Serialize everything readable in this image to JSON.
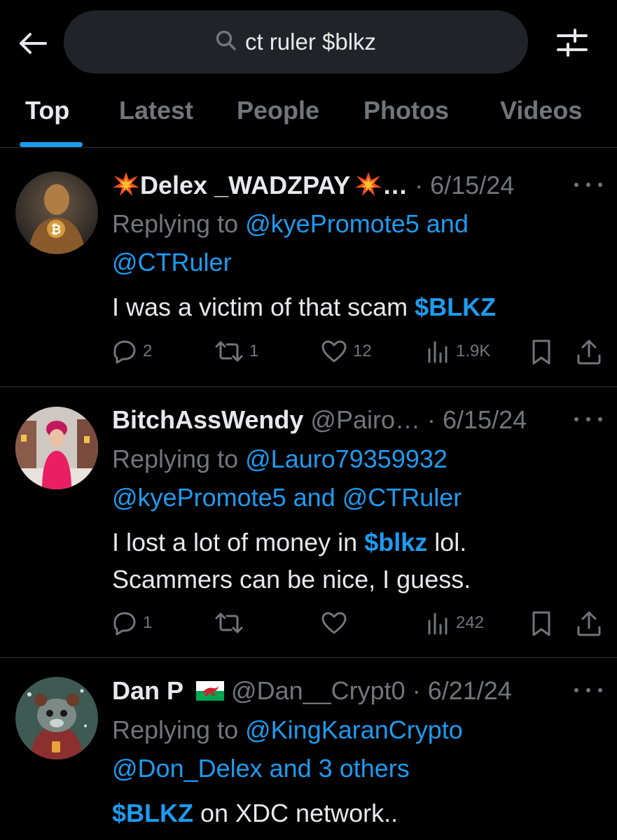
{
  "header": {
    "search_query": "ct ruler $blkz"
  },
  "tabs": [
    {
      "label": "Top",
      "active": true
    },
    {
      "label": "Latest",
      "active": false
    },
    {
      "label": "People",
      "active": false
    },
    {
      "label": "Photos",
      "active": false
    },
    {
      "label": "Videos",
      "active": false
    }
  ],
  "tweets": [
    {
      "display_name": "Delex _WADZPAY",
      "handle": "…",
      "date": "6/15/24",
      "replying_prefix": "Replying to",
      "replying_line1": "@kyePromote5 and",
      "replying_line2": "@CTRuler",
      "text_pre": "I was a victim of that scam ",
      "cashtag": "$BLKZ",
      "replies": "2",
      "retweets": "1",
      "likes": "12",
      "views": "1.9K"
    },
    {
      "display_name": "BitchAssWendy",
      "handle": "@Pairo…",
      "date": "6/15/24",
      "replying_prefix": "Replying to",
      "replying_line1": "@Lauro79359932",
      "replying_line2": "@kyePromote5 and @CTRuler",
      "text_pre": "I lost a lot of money in ",
      "cashtag": "$blkz",
      "text_post": " lol.",
      "text_line2": "Scammers can be nice, I guess.",
      "replies": "1",
      "retweets": "",
      "likes": "",
      "views": "242"
    },
    {
      "display_name": "Dan P",
      "handle": "@Dan__Crypt0",
      "date": "6/21/24",
      "replying_prefix": "Replying to",
      "replying_line1": "@KingKaranCrypto",
      "replying_line2": "@Don_Delex and 3 others",
      "cashtag": "$BLKZ",
      "text_post": " on XDC network.."
    }
  ],
  "colors": {
    "background": "#000000",
    "accent": "#1d9bf0",
    "secondary_text": "#71767b",
    "primary_text": "#e7e9ea",
    "search_bg": "#202327"
  }
}
